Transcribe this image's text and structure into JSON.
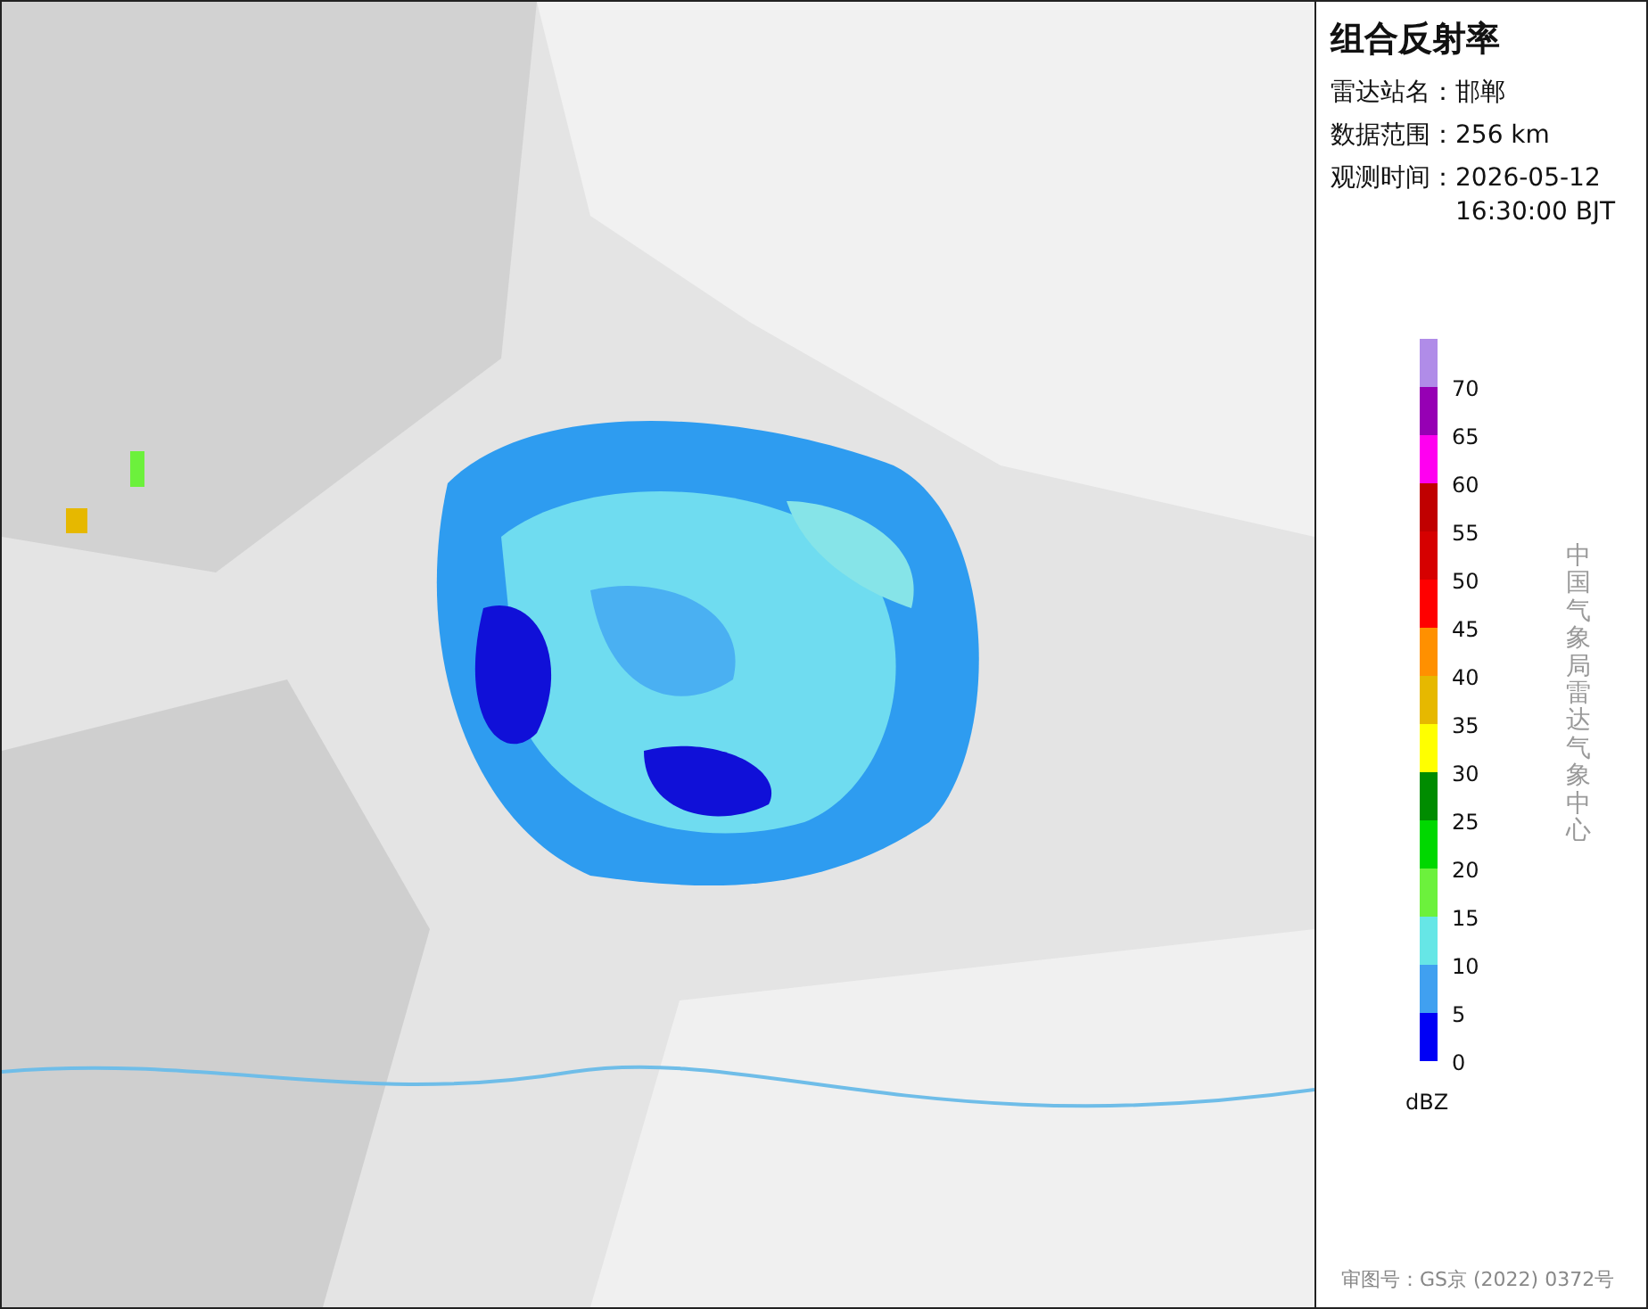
{
  "panel": {
    "title": "组合反射率",
    "info": [
      {
        "label": "雷达站名：",
        "value": "邯郸"
      },
      {
        "label": "数据范围：",
        "value": "256 km"
      },
      {
        "label": "观测时间：",
        "value": "2026-05-12 16:30:00 BJT"
      }
    ],
    "legend": {
      "segments": [
        {
          "label": "70",
          "color": "#b08ce8"
        },
        {
          "label": "65",
          "color": "#9600b4"
        },
        {
          "label": "60",
          "color": "#ff00f0"
        },
        {
          "label": "55",
          "color": "#c00000"
        },
        {
          "label": "50",
          "color": "#d60000"
        },
        {
          "label": "45",
          "color": "#ff0000"
        },
        {
          "label": "40",
          "color": "#ff9000"
        },
        {
          "label": "35",
          "color": "#e6b800"
        },
        {
          "label": "30",
          "color": "#ffff00"
        },
        {
          "label": "25",
          "color": "#008c00"
        },
        {
          "label": "20",
          "color": "#00d800"
        },
        {
          "label": "15",
          "color": "#6cf13c"
        },
        {
          "label": "10",
          "color": "#66e6e6"
        },
        {
          "label": "5",
          "color": "#40a0f0"
        },
        {
          "label": "0",
          "color": "#0000f6"
        }
      ],
      "unit": "dBZ"
    },
    "credit": "中国气象局雷达气象中心",
    "approval": "审图号：GS京 (2022) 0372号"
  }
}
